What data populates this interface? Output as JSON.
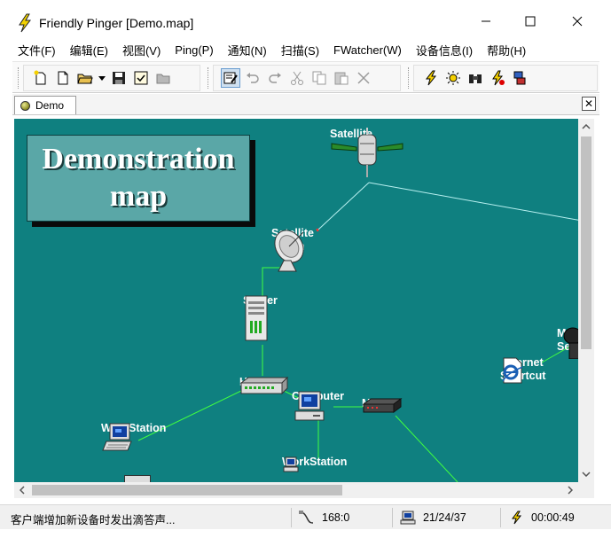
{
  "window": {
    "title": "Friendly Pinger [Demo.map]",
    "minimize_glyph": "—",
    "maximize_glyph": "☐",
    "close_glyph": "✕"
  },
  "menu": [
    "文件(F)",
    "编辑(E)",
    "视图(V)",
    "Ping(P)",
    "通知(N)",
    "扫描(S)",
    "FWatcher(W)",
    "设备信息(I)",
    "帮助(H)"
  ],
  "toolbar": {
    "group1": [
      "new-wizard-icon",
      "new-file-icon",
      "open-folder-icon",
      "dropdown-arrow-icon",
      "save-disk-icon",
      "checklist-icon",
      "folder-gray-icon"
    ],
    "group2": [
      "edit-properties-icon",
      "undo-icon",
      "redo-icon",
      "cut-icon",
      "copy-icon",
      "paste-icon",
      "delete-icon"
    ],
    "group3": [
      "ping-lightning-icon",
      "sun-alert-icon",
      "binoculars-icon",
      "lightning-stop-icon",
      "network-monitor-icon"
    ]
  },
  "tabs": [
    {
      "label": "Demo",
      "active": true
    }
  ],
  "tab_close_glyph": "✕",
  "map": {
    "background_color": "#0f8080",
    "banner_lines": [
      "Demonstration",
      "map"
    ],
    "nodes": [
      {
        "id": "satellite",
        "label": "Satellite"
      },
      {
        "id": "dish",
        "label": "Satellite\nDish"
      },
      {
        "id": "server",
        "label": "Server"
      },
      {
        "id": "hub",
        "label": "Hub"
      },
      {
        "id": "computer",
        "label": "Computer"
      },
      {
        "id": "modem",
        "label": "Modem"
      },
      {
        "id": "workstation1",
        "label": "WorkStation"
      },
      {
        "id": "workstation2",
        "label": "WorkStation"
      },
      {
        "id": "internet-shortcut",
        "label": "Internet\nShortcut"
      },
      {
        "id": "mail-server",
        "label": "M\nSe"
      }
    ]
  },
  "scrollbars": {
    "up": "▲",
    "down": "▼",
    "left": "◀",
    "right": "▶"
  },
  "status": {
    "message": "客户端增加新设备时发出滴答声...",
    "field1": "168:0",
    "field2": "21/24/37",
    "field3": "00:00:49"
  }
}
